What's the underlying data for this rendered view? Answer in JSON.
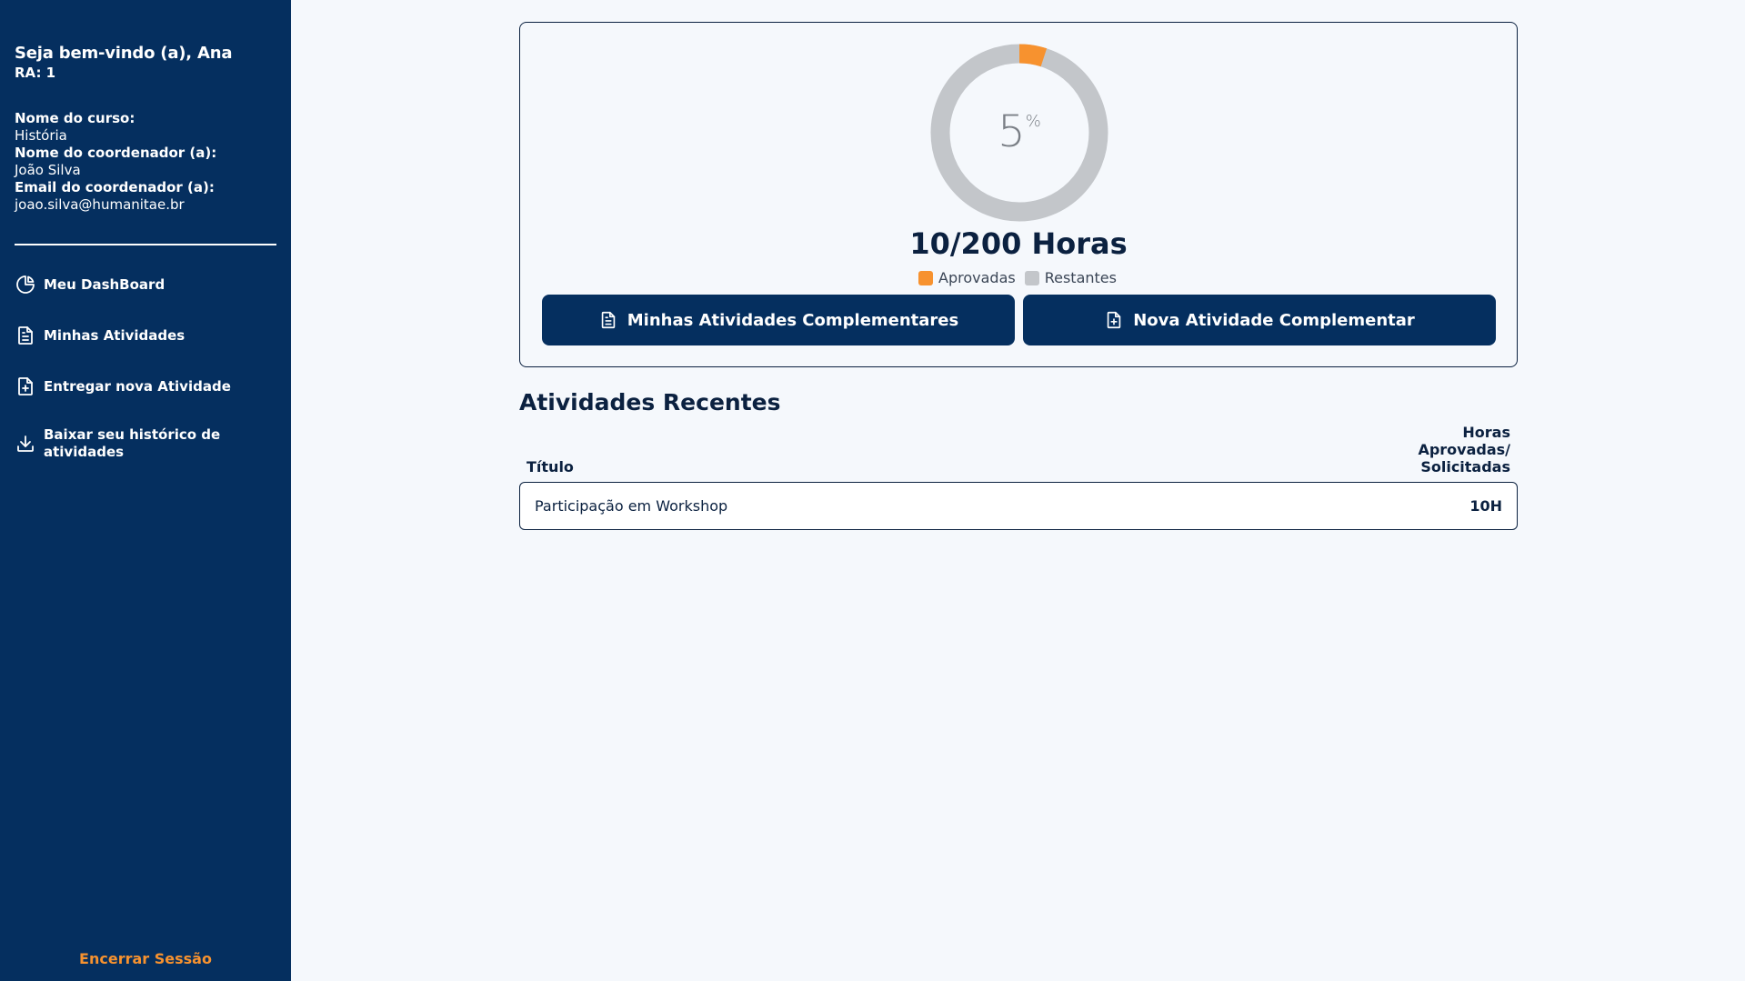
{
  "sidebar": {
    "welcome": "Seja bem-vindo (a), Ana",
    "ra": "RA: 1",
    "course_label": "Nome do curso:",
    "course_value": "História",
    "coordinator_label": "Nome do coordenador (a):",
    "coordinator_value": "João Silva",
    "email_label": "Email do coordenador (a):",
    "email_value": "joao.silva@humanitae.br",
    "nav": [
      {
        "label": "Meu DashBoard",
        "icon": "pie-chart-icon"
      },
      {
        "label": "Minhas Atividades",
        "icon": "document-icon"
      },
      {
        "label": "Entregar nova Atividade",
        "icon": "document-plus-icon"
      },
      {
        "label": "Baixar seu histórico de atividades",
        "icon": "download-icon"
      }
    ],
    "logout": "Encerrar Sessão"
  },
  "progress": {
    "percent": 5,
    "percent_value": "5",
    "percent_symbol": "%",
    "approved_hours": 10,
    "total_hours": 200,
    "hours_text": "10/200 Horas",
    "legend_approved": "Aprovadas",
    "legend_remaining": "Restantes"
  },
  "colors": {
    "navy": "#052f5f",
    "approved": "#f7922f",
    "remaining": "#c3c6ca"
  },
  "buttons": {
    "my_activities": "Minhas Atividades Complementares",
    "new_activity": "Nova Atividade Complementar"
  },
  "recent": {
    "title": "Atividades Recentes",
    "col_title": "Título",
    "col_hours_line1": "Horas",
    "col_hours_line2": "Aprovadas/",
    "col_hours_line3": "Solicitadas",
    "rows": [
      {
        "title": "Participação em Workshop",
        "hours": "10H"
      }
    ]
  }
}
